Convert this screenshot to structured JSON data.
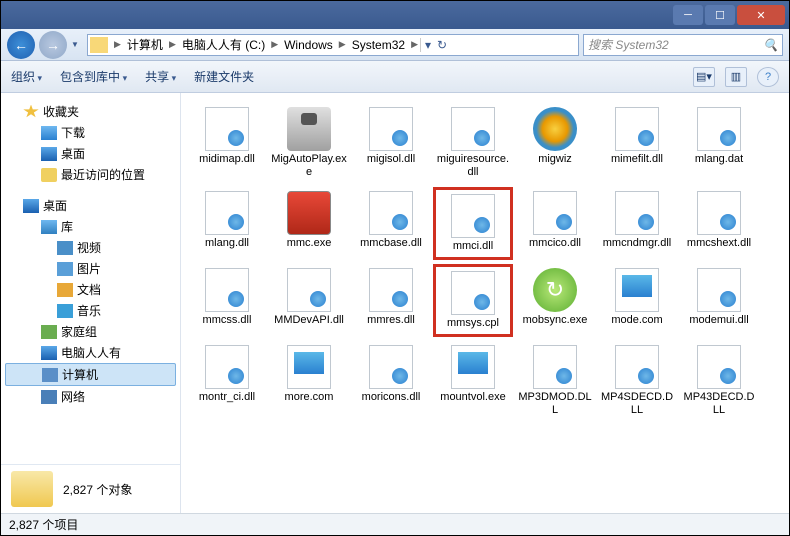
{
  "window": {
    "title": ""
  },
  "nav": {
    "crumbs": [
      "计算机",
      "电脑人人有 (C:)",
      "Windows",
      "System32"
    ],
    "search_placeholder": "搜索 System32"
  },
  "toolbar": {
    "organize": "组织",
    "include": "包含到库中",
    "share": "共享",
    "newfolder": "新建文件夹"
  },
  "sidebar": {
    "favorites": "收藏夹",
    "downloads": "下载",
    "desktop": "桌面",
    "recent": "最近访问的位置",
    "desktop2": "桌面",
    "libraries": "库",
    "videos": "视频",
    "pictures": "图片",
    "documents": "文档",
    "music": "音乐",
    "homegroup": "家庭组",
    "user": "电脑人人有",
    "computer": "计算机",
    "network": "网络",
    "count_label": "2,827 个对象"
  },
  "files": [
    {
      "name": "midimap.dll",
      "icon": "dll"
    },
    {
      "name": "MigAutoPlay.exe",
      "icon": "exe"
    },
    {
      "name": "migisol.dll",
      "icon": "dll"
    },
    {
      "name": "miguiresource.dll",
      "icon": "dll"
    },
    {
      "name": "migwiz",
      "icon": "mig"
    },
    {
      "name": "mimefilt.dll",
      "icon": "dll"
    },
    {
      "name": "mlang.dat",
      "icon": "dll"
    },
    {
      "name": "mlang.dll",
      "icon": "dll"
    },
    {
      "name": "mmc.exe",
      "icon": "mmc"
    },
    {
      "name": "mmcbase.dll",
      "icon": "dll"
    },
    {
      "name": "mmci.dll",
      "icon": "dll",
      "hl": true
    },
    {
      "name": "mmcico.dll",
      "icon": "dll"
    },
    {
      "name": "mmcndmgr.dll",
      "icon": "dll"
    },
    {
      "name": "mmcshext.dll",
      "icon": "dll"
    },
    {
      "name": "mmcss.dll",
      "icon": "dll"
    },
    {
      "name": "MMDevAPI.dll",
      "icon": "dll"
    },
    {
      "name": "mmres.dll",
      "icon": "dll"
    },
    {
      "name": "mmsys.cpl",
      "icon": "dll",
      "hl": true
    },
    {
      "name": "mobsync.exe",
      "icon": "sync"
    },
    {
      "name": "mode.com",
      "icon": "win"
    },
    {
      "name": "modemui.dll",
      "icon": "dll"
    },
    {
      "name": "montr_ci.dll",
      "icon": "dll"
    },
    {
      "name": "more.com",
      "icon": "win"
    },
    {
      "name": "moricons.dll",
      "icon": "dll"
    },
    {
      "name": "mountvol.exe",
      "icon": "win"
    },
    {
      "name": "MP3DMOD.DLL",
      "icon": "dll"
    },
    {
      "name": "MP4SDECD.DLL",
      "icon": "dll"
    },
    {
      "name": "MP43DECD.DLL",
      "icon": "dll"
    }
  ],
  "status": {
    "items": "2,827 个项目"
  }
}
